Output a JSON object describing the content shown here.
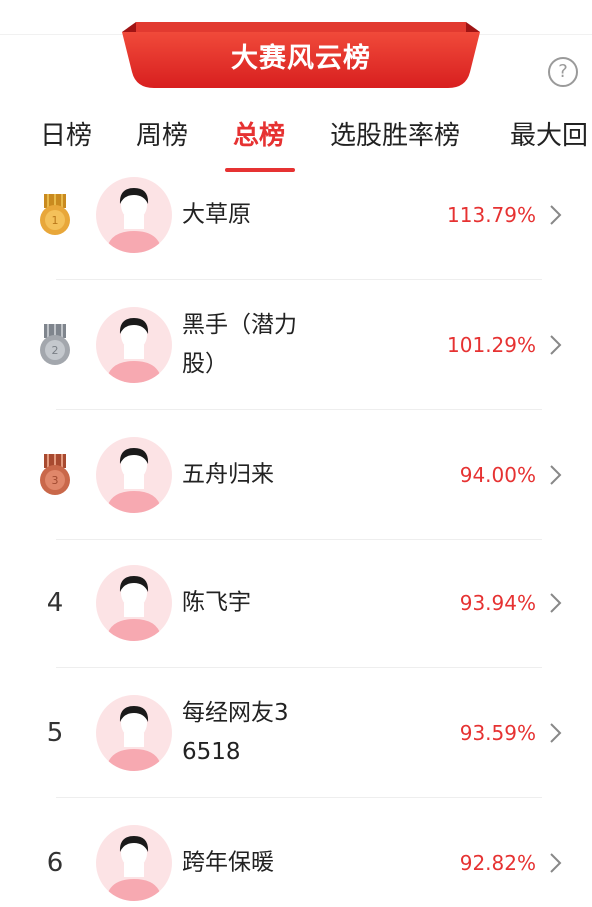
{
  "banner": {
    "title": "大赛风云榜"
  },
  "help": {
    "icon": "question-mark-icon",
    "glyph": "?"
  },
  "tabs": [
    {
      "label": "日榜",
      "active": false
    },
    {
      "label": "周榜",
      "active": false
    },
    {
      "label": "总榜",
      "active": true
    },
    {
      "label": "选股胜率榜",
      "active": false
    },
    {
      "label": "最大回",
      "active": false
    }
  ],
  "colors": {
    "accent": "#e63232",
    "avatar_bg": "#fce3e5",
    "gold": "#e8a73a",
    "silver": "#a3a7ad",
    "bronze": "#c9684a"
  },
  "rows": [
    {
      "rank": "1",
      "medal": "gold",
      "name": "大草原",
      "percent": "113.79%"
    },
    {
      "rank": "2",
      "medal": "silver",
      "name": "黑手（潜力股）",
      "percent": "101.29%"
    },
    {
      "rank": "3",
      "medal": "bronze",
      "name": "五舟归来",
      "percent": "94.00%"
    },
    {
      "rank": "4",
      "medal": "",
      "name": "陈飞宇",
      "percent": "93.94%"
    },
    {
      "rank": "5",
      "medal": "",
      "name": "每经网友36518",
      "percent": "93.59%"
    },
    {
      "rank": "6",
      "medal": "",
      "name": "跨年保暖",
      "percent": "92.82%"
    }
  ]
}
